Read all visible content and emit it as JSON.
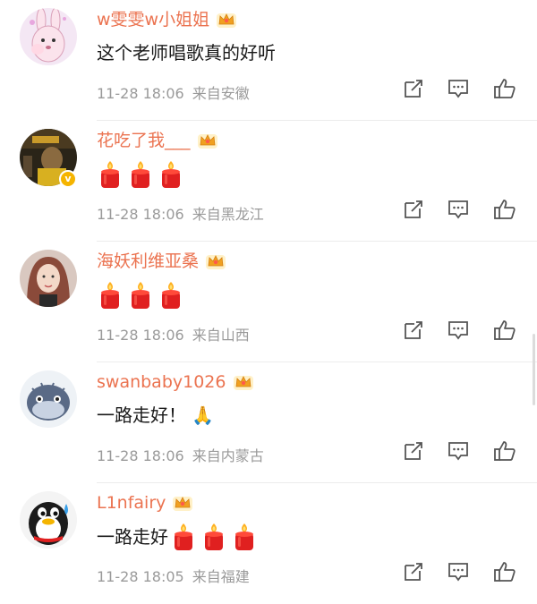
{
  "comments": [
    {
      "username": "w雯雯w小姐姐",
      "text": "这个老师唱歌真的好听",
      "time": "11-28 18:06",
      "location": "来自安徽",
      "candles": 0,
      "verified": false,
      "avatar": "pink-cartoon-rabbit-avatar"
    },
    {
      "username": "花吃了我___",
      "text": "",
      "time": "11-28 18:06",
      "location": "来自黑龙江",
      "candles": 3,
      "verified": true,
      "avatar": "dark-photo-avatar"
    },
    {
      "username": "海妖利维亚桑",
      "text": "",
      "time": "11-28 18:06",
      "location": "来自山西",
      "candles": 3,
      "verified": false,
      "avatar": "girl-portrait-avatar"
    },
    {
      "username": "swanbaby1026",
      "text": "一路走好！",
      "time": "11-28 18:06",
      "location": "来自内蒙古",
      "candles": 0,
      "pray": "🙏",
      "verified": false,
      "avatar": "pufferfish-avatar"
    },
    {
      "username": "L1nfairy",
      "text": "一路走好",
      "time": "11-28 18:05",
      "location": "来自福建",
      "candles": 3,
      "verified": false,
      "avatar": "qq-penguin-avatar"
    }
  ],
  "icons": {
    "share": "share-icon",
    "reply": "comment-icon",
    "like": "thumbs-up-icon",
    "badge": "crown-icon",
    "candle": "candle-emoji-icon"
  },
  "colors": {
    "username": "#eb7350",
    "meta": "#9a9a9a",
    "text": "#1a1a1a",
    "candle": "#e02020",
    "crown": "#f0a020"
  }
}
